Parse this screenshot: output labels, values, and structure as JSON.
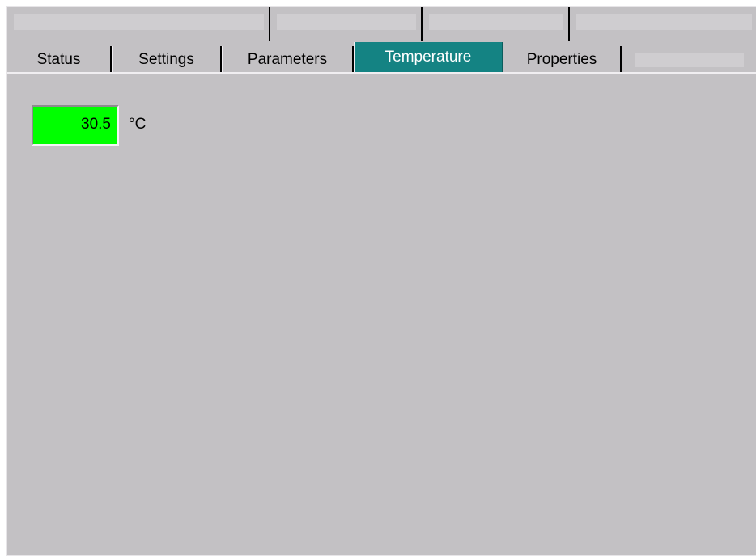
{
  "tabs_back_row": [
    "",
    "",
    "",
    ""
  ],
  "tabs": [
    {
      "label": "Status"
    },
    {
      "label": "Settings"
    },
    {
      "label": "Parameters"
    },
    {
      "label": "Temperature",
      "active": true
    },
    {
      "label": "Properties"
    },
    {
      "label": ""
    }
  ],
  "temperature": {
    "value": "30.5",
    "unit": "°C",
    "indicator_color": "#00ff00"
  },
  "colors": {
    "panel_bg": "#c3c1c4",
    "active_tab_bg": "#148383",
    "active_tab_text": "#ffffff"
  }
}
